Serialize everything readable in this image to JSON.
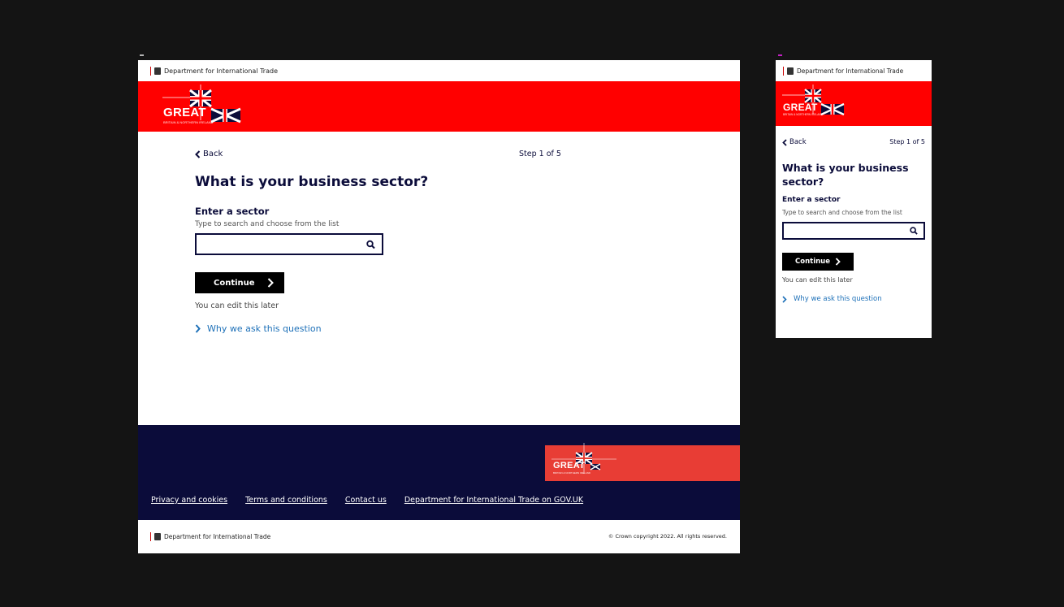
{
  "colors": {
    "background": "#141414",
    "brand_red": "#ff0000",
    "navy": "#0b0c3a",
    "link_blue": "#1d70b8",
    "footer_red": "#e83d35",
    "desktop_marker": "#b4b4b4",
    "mobile_marker": "#c020c0"
  },
  "icons": {
    "crest": "royal-crest-icon",
    "flag": "union-flag-icon",
    "back": "chevron-left-icon",
    "search": "search-icon",
    "continue": "chevron-right-icon",
    "why": "chevron-right-icon"
  },
  "desktop": {
    "header": {
      "department": "Department for International Trade",
      "logo_text": "GREAT",
      "logo_subtitle": "BRITAIN & NORTHERN IRELAND"
    },
    "nav": {
      "back": "Back",
      "step": "Step 1 of 5"
    },
    "question": {
      "title": "What is your business sector?",
      "field_label": "Enter a sector",
      "hint": "Type to search and choose from the list",
      "input_value": "",
      "continue": "Continue",
      "edit_note": "You can edit this later",
      "why": "Why we ask this question"
    },
    "footer": {
      "logo_text": "GREAT",
      "logo_subtitle": "BRITAIN & NORTHERN IRELAND",
      "links": [
        "Privacy and cookies",
        "Terms and conditions",
        "Contact us",
        "Department for International Trade on GOV.UK"
      ],
      "department": "Department for International Trade",
      "copyright": "© Crown copyright 2022. All rights reserved."
    }
  },
  "mobile": {
    "header": {
      "department": "Department for International Trade",
      "logo_text": "GREAT",
      "logo_subtitle": "BRITAIN & NORTHERN IRELAND"
    },
    "nav": {
      "back": "Back",
      "step": "Step 1 of 5"
    },
    "question": {
      "title": "What is your business sector?",
      "field_label": "Enter a sector",
      "hint": "Type to search and choose from the list",
      "input_value": "",
      "continue": "Continue",
      "edit_note": "You can edit this later",
      "why": "Why we ask this question"
    }
  }
}
